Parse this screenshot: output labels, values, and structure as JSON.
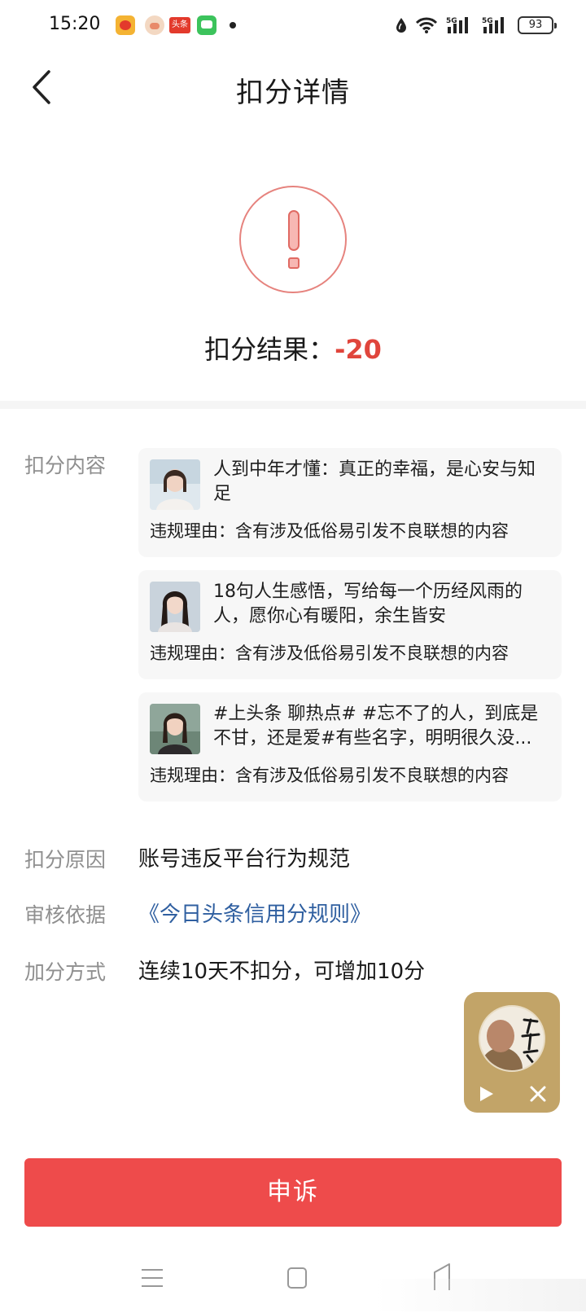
{
  "status_bar": {
    "time": "15:20",
    "tt_badge": "头条",
    "battery": "93",
    "signal_labels": [
      "5G",
      "5G"
    ]
  },
  "header": {
    "title": "扣分详情",
    "back_icon": "chevron-left-icon"
  },
  "result": {
    "label": "扣分结果：",
    "value": "-20",
    "accent_color": "#e0453c"
  },
  "details": {
    "content_label": "扣分内容",
    "items": [
      {
        "title": "人到中年才懂：真正的幸福，是心安与知足",
        "reason": "违规理由：含有涉及低俗易引发不良联想的内容"
      },
      {
        "title": "18句人生感悟，写给每一个历经风雨的人，愿你心有暖阳，余生皆安",
        "reason": "违规理由：含有涉及低俗易引发不良联想的内容"
      },
      {
        "title": "#上头条 聊热点# #忘不了的人，到底是不甘，还是爱#有些名字，明明很久没...",
        "reason": "违规理由：含有涉及低俗易引发不良联想的内容"
      }
    ],
    "reason_label": "扣分原因",
    "reason_value": "账号违反平台行为规范",
    "basis_label": "审核依据",
    "basis_value": "《今日头条信用分规则》",
    "bonus_label": "加分方式",
    "bonus_value": "连续10天不扣分，可增加10分"
  },
  "float_player": {
    "avatar_text": "弘一法师"
  },
  "appeal_button": "申诉"
}
